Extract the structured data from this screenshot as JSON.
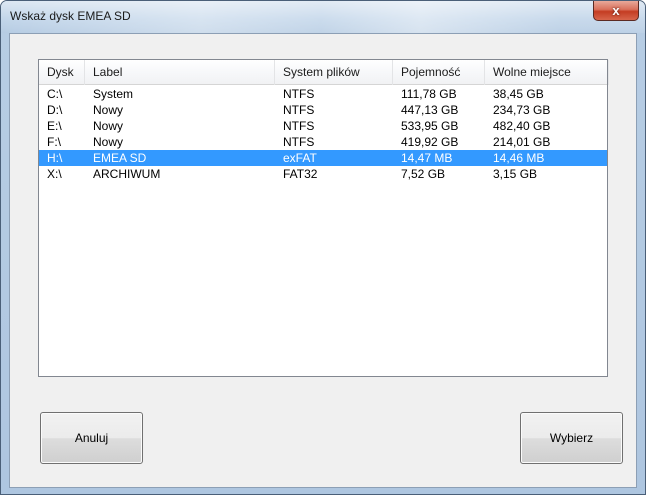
{
  "window": {
    "title": "Wskaż dysk EMEA SD",
    "close_label": "x"
  },
  "drive_list": {
    "columns": [
      "Dysk",
      "Label",
      "System plików",
      "Pojemność",
      "Wolne miejsce"
    ],
    "rows": [
      {
        "drive": "C:\\",
        "label": "System",
        "filesystem": "NTFS",
        "capacity": "111,78 GB",
        "free": "38,45 GB",
        "selected": false
      },
      {
        "drive": "D:\\",
        "label": "Nowy",
        "filesystem": "NTFS",
        "capacity": "447,13 GB",
        "free": "234,73 GB",
        "selected": false
      },
      {
        "drive": "E:\\",
        "label": "Nowy",
        "filesystem": "NTFS",
        "capacity": "533,95 GB",
        "free": "482,40 GB",
        "selected": false
      },
      {
        "drive": "F:\\",
        "label": "Nowy",
        "filesystem": "NTFS",
        "capacity": "419,92 GB",
        "free": "214,01 GB",
        "selected": false
      },
      {
        "drive": "H:\\",
        "label": "EMEA SD",
        "filesystem": "exFAT",
        "capacity": "14,47 MB",
        "free": "14,46 MB",
        "selected": true
      },
      {
        "drive": "X:\\",
        "label": "ARCHIWUM",
        "filesystem": "FAT32",
        "capacity": "7,52 GB",
        "free": "3,15 GB",
        "selected": false
      }
    ],
    "selection_color": "#3399ff"
  },
  "buttons": {
    "cancel_label": "Anuluj",
    "choose_label": "Wybierz"
  }
}
